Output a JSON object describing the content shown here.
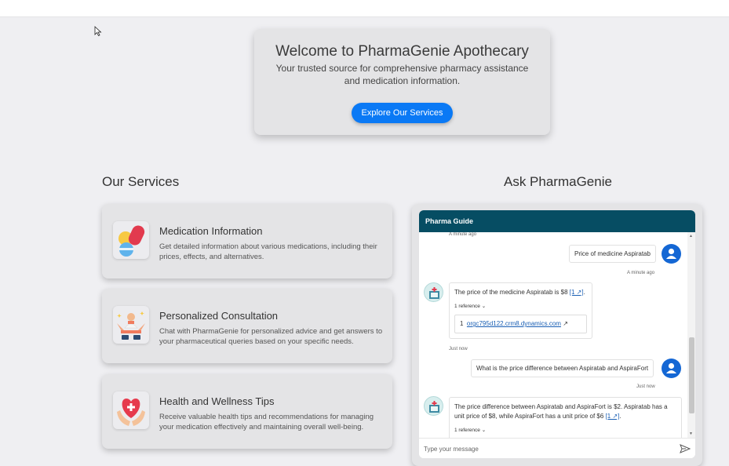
{
  "hero": {
    "title": "Welcome to PharmaGenie Apothecary",
    "subtitle": "Your trusted source for comprehensive pharmacy assistance and medication information.",
    "button_label": "Explore Our Services"
  },
  "services": {
    "heading": "Our Services",
    "items": [
      {
        "title": "Medication Information",
        "description": "Get detailed information about various medications, including their prices, effects, and alternatives.",
        "icon": "pills-icon"
      },
      {
        "title": "Personalized Consultation",
        "description": "Chat with PharmaGenie for personalized advice and get answers to your pharmaceutical queries based on your specific needs.",
        "icon": "consultation-icon"
      },
      {
        "title": "Health and Wellness Tips",
        "description": "Receive valuable health tips and recommendations for managing your medication effectively and maintaining overall well-being.",
        "icon": "heart-hands-icon"
      }
    ]
  },
  "chat": {
    "heading": "Ask PharmaGenie",
    "header_title": "Pharma Guide",
    "messages": {
      "top_timestamp": "A minute ago",
      "user1": "Price of medicine Aspiratab",
      "user1_time": "A minute ago",
      "bot1_pre": "The price of the medicine Aspiratab is $8 ",
      "bot1_ref": "[1 ↗]",
      "bot1_post": ".",
      "bot1_refcount": "1 reference",
      "bot1_ref_index": "1",
      "bot1_ref_link": "orgc795d122.crm8.dynamics.com",
      "bot1_time": "Just now",
      "user2": "What is the price difference between Aspiratab and AspiraFort",
      "user2_time": "Just now",
      "bot2_pre": "The price difference between Aspiratab and AspiraFort is $2. Aspiratab has a unit price of $8, while AspiraFort has a unit price of $6 ",
      "bot2_ref": "[1 ↗]",
      "bot2_post": ".",
      "bot2_refcount": "1 reference"
    },
    "input_placeholder": "Type your message"
  },
  "colors": {
    "accent": "#0a79f5",
    "chat_header": "#064d63",
    "user_avatar": "#1467d4",
    "background": "#efeff2",
    "card": "#e4e4e6"
  }
}
